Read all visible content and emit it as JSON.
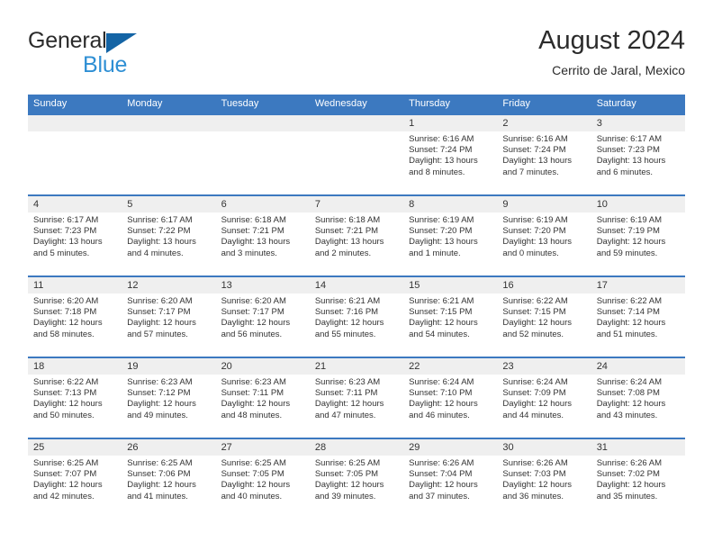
{
  "brand": {
    "line1": "General",
    "line2": "Blue",
    "triangle_color": "#1464a5",
    "blue_text_color": "#2e8fd4"
  },
  "header": {
    "title": "August 2024",
    "subtitle": "Cerrito de Jaral, Mexico"
  },
  "colors": {
    "header_row_bg": "#3c79c0",
    "header_row_text": "#ffffff",
    "day_number_band_bg": "#efefef",
    "cell_bg": "#ffffff",
    "text": "#333333"
  },
  "day_headers": [
    "Sunday",
    "Monday",
    "Tuesday",
    "Wednesday",
    "Thursday",
    "Friday",
    "Saturday"
  ],
  "weeks": [
    [
      {
        "day": "",
        "sunrise": "",
        "sunset": "",
        "daylight_line1": "",
        "daylight_line2": ""
      },
      {
        "day": "",
        "sunrise": "",
        "sunset": "",
        "daylight_line1": "",
        "daylight_line2": ""
      },
      {
        "day": "",
        "sunrise": "",
        "sunset": "",
        "daylight_line1": "",
        "daylight_line2": ""
      },
      {
        "day": "",
        "sunrise": "",
        "sunset": "",
        "daylight_line1": "",
        "daylight_line2": ""
      },
      {
        "day": "1",
        "sunrise": "Sunrise: 6:16 AM",
        "sunset": "Sunset: 7:24 PM",
        "daylight_line1": "Daylight: 13 hours",
        "daylight_line2": "and 8 minutes."
      },
      {
        "day": "2",
        "sunrise": "Sunrise: 6:16 AM",
        "sunset": "Sunset: 7:24 PM",
        "daylight_line1": "Daylight: 13 hours",
        "daylight_line2": "and 7 minutes."
      },
      {
        "day": "3",
        "sunrise": "Sunrise: 6:17 AM",
        "sunset": "Sunset: 7:23 PM",
        "daylight_line1": "Daylight: 13 hours",
        "daylight_line2": "and 6 minutes."
      }
    ],
    [
      {
        "day": "4",
        "sunrise": "Sunrise: 6:17 AM",
        "sunset": "Sunset: 7:23 PM",
        "daylight_line1": "Daylight: 13 hours",
        "daylight_line2": "and 5 minutes."
      },
      {
        "day": "5",
        "sunrise": "Sunrise: 6:17 AM",
        "sunset": "Sunset: 7:22 PM",
        "daylight_line1": "Daylight: 13 hours",
        "daylight_line2": "and 4 minutes."
      },
      {
        "day": "6",
        "sunrise": "Sunrise: 6:18 AM",
        "sunset": "Sunset: 7:21 PM",
        "daylight_line1": "Daylight: 13 hours",
        "daylight_line2": "and 3 minutes."
      },
      {
        "day": "7",
        "sunrise": "Sunrise: 6:18 AM",
        "sunset": "Sunset: 7:21 PM",
        "daylight_line1": "Daylight: 13 hours",
        "daylight_line2": "and 2 minutes."
      },
      {
        "day": "8",
        "sunrise": "Sunrise: 6:19 AM",
        "sunset": "Sunset: 7:20 PM",
        "daylight_line1": "Daylight: 13 hours",
        "daylight_line2": "and 1 minute."
      },
      {
        "day": "9",
        "sunrise": "Sunrise: 6:19 AM",
        "sunset": "Sunset: 7:20 PM",
        "daylight_line1": "Daylight: 13 hours",
        "daylight_line2": "and 0 minutes."
      },
      {
        "day": "10",
        "sunrise": "Sunrise: 6:19 AM",
        "sunset": "Sunset: 7:19 PM",
        "daylight_line1": "Daylight: 12 hours",
        "daylight_line2": "and 59 minutes."
      }
    ],
    [
      {
        "day": "11",
        "sunrise": "Sunrise: 6:20 AM",
        "sunset": "Sunset: 7:18 PM",
        "daylight_line1": "Daylight: 12 hours",
        "daylight_line2": "and 58 minutes."
      },
      {
        "day": "12",
        "sunrise": "Sunrise: 6:20 AM",
        "sunset": "Sunset: 7:17 PM",
        "daylight_line1": "Daylight: 12 hours",
        "daylight_line2": "and 57 minutes."
      },
      {
        "day": "13",
        "sunrise": "Sunrise: 6:20 AM",
        "sunset": "Sunset: 7:17 PM",
        "daylight_line1": "Daylight: 12 hours",
        "daylight_line2": "and 56 minutes."
      },
      {
        "day": "14",
        "sunrise": "Sunrise: 6:21 AM",
        "sunset": "Sunset: 7:16 PM",
        "daylight_line1": "Daylight: 12 hours",
        "daylight_line2": "and 55 minutes."
      },
      {
        "day": "15",
        "sunrise": "Sunrise: 6:21 AM",
        "sunset": "Sunset: 7:15 PM",
        "daylight_line1": "Daylight: 12 hours",
        "daylight_line2": "and 54 minutes."
      },
      {
        "day": "16",
        "sunrise": "Sunrise: 6:22 AM",
        "sunset": "Sunset: 7:15 PM",
        "daylight_line1": "Daylight: 12 hours",
        "daylight_line2": "and 52 minutes."
      },
      {
        "day": "17",
        "sunrise": "Sunrise: 6:22 AM",
        "sunset": "Sunset: 7:14 PM",
        "daylight_line1": "Daylight: 12 hours",
        "daylight_line2": "and 51 minutes."
      }
    ],
    [
      {
        "day": "18",
        "sunrise": "Sunrise: 6:22 AM",
        "sunset": "Sunset: 7:13 PM",
        "daylight_line1": "Daylight: 12 hours",
        "daylight_line2": "and 50 minutes."
      },
      {
        "day": "19",
        "sunrise": "Sunrise: 6:23 AM",
        "sunset": "Sunset: 7:12 PM",
        "daylight_line1": "Daylight: 12 hours",
        "daylight_line2": "and 49 minutes."
      },
      {
        "day": "20",
        "sunrise": "Sunrise: 6:23 AM",
        "sunset": "Sunset: 7:11 PM",
        "daylight_line1": "Daylight: 12 hours",
        "daylight_line2": "and 48 minutes."
      },
      {
        "day": "21",
        "sunrise": "Sunrise: 6:23 AM",
        "sunset": "Sunset: 7:11 PM",
        "daylight_line1": "Daylight: 12 hours",
        "daylight_line2": "and 47 minutes."
      },
      {
        "day": "22",
        "sunrise": "Sunrise: 6:24 AM",
        "sunset": "Sunset: 7:10 PM",
        "daylight_line1": "Daylight: 12 hours",
        "daylight_line2": "and 46 minutes."
      },
      {
        "day": "23",
        "sunrise": "Sunrise: 6:24 AM",
        "sunset": "Sunset: 7:09 PM",
        "daylight_line1": "Daylight: 12 hours",
        "daylight_line2": "and 44 minutes."
      },
      {
        "day": "24",
        "sunrise": "Sunrise: 6:24 AM",
        "sunset": "Sunset: 7:08 PM",
        "daylight_line1": "Daylight: 12 hours",
        "daylight_line2": "and 43 minutes."
      }
    ],
    [
      {
        "day": "25",
        "sunrise": "Sunrise: 6:25 AM",
        "sunset": "Sunset: 7:07 PM",
        "daylight_line1": "Daylight: 12 hours",
        "daylight_line2": "and 42 minutes."
      },
      {
        "day": "26",
        "sunrise": "Sunrise: 6:25 AM",
        "sunset": "Sunset: 7:06 PM",
        "daylight_line1": "Daylight: 12 hours",
        "daylight_line2": "and 41 minutes."
      },
      {
        "day": "27",
        "sunrise": "Sunrise: 6:25 AM",
        "sunset": "Sunset: 7:05 PM",
        "daylight_line1": "Daylight: 12 hours",
        "daylight_line2": "and 40 minutes."
      },
      {
        "day": "28",
        "sunrise": "Sunrise: 6:25 AM",
        "sunset": "Sunset: 7:05 PM",
        "daylight_line1": "Daylight: 12 hours",
        "daylight_line2": "and 39 minutes."
      },
      {
        "day": "29",
        "sunrise": "Sunrise: 6:26 AM",
        "sunset": "Sunset: 7:04 PM",
        "daylight_line1": "Daylight: 12 hours",
        "daylight_line2": "and 37 minutes."
      },
      {
        "day": "30",
        "sunrise": "Sunrise: 6:26 AM",
        "sunset": "Sunset: 7:03 PM",
        "daylight_line1": "Daylight: 12 hours",
        "daylight_line2": "and 36 minutes."
      },
      {
        "day": "31",
        "sunrise": "Sunrise: 6:26 AM",
        "sunset": "Sunset: 7:02 PM",
        "daylight_line1": "Daylight: 12 hours",
        "daylight_line2": "and 35 minutes."
      }
    ]
  ]
}
